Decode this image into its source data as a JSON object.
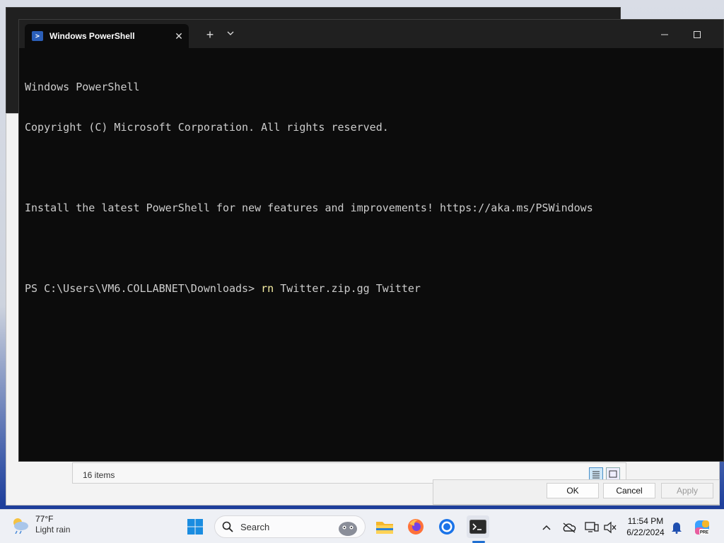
{
  "terminal": {
    "tab_title": "Windows PowerShell",
    "tab_close": "✕",
    "new_tab": "+",
    "tab_dropdown": "⌄",
    "lines": [
      "Windows PowerShell",
      "Copyright (C) Microsoft Corporation. All rights reserved.",
      "",
      "Install the latest PowerShell for new features and improvements! https://aka.ms/PSWindows",
      ""
    ],
    "prompt": "PS C:\\Users\\VM6.COLLABNET\\Downloads> ",
    "command_name": "rn",
    "command_args": " Twitter.zip.gg Twitter"
  },
  "explorer": {
    "status_items": "16 items"
  },
  "dialog": {
    "ok_label": "OK",
    "cancel_label": "Cancel",
    "apply_label": "Apply"
  },
  "taskbar": {
    "weather_temp": "77°F",
    "weather_desc": "Light rain",
    "search_label": "Search",
    "time": "11:54 PM",
    "date": "6/22/2024"
  },
  "colors": {
    "terminal_bg": "#0c0c0c",
    "terminal_text": "#cccccc",
    "command_highlight": "#f9f1a5",
    "taskbar_bg": "#eef0f5",
    "accent": "#1f6fd1"
  },
  "icons": [
    "powershell-icon",
    "start-icon",
    "search-icon",
    "file-explorer-icon",
    "firefox-icon",
    "chrome-icon",
    "terminal-icon",
    "chevron-up-icon",
    "onedrive-icon",
    "network-icon",
    "volume-icon",
    "notification-bell-icon",
    "copilot-icon",
    "weather-icon"
  ]
}
